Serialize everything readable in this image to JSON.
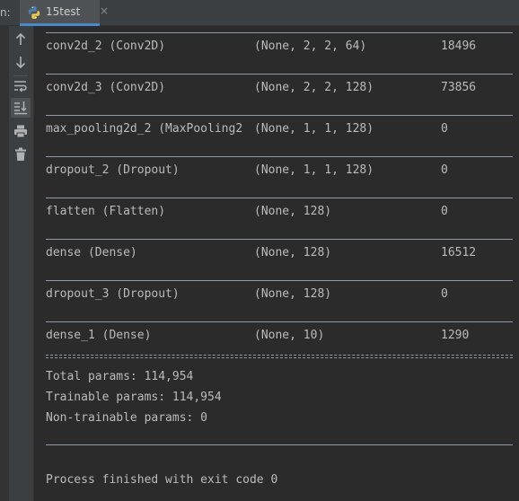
{
  "run_panel": {
    "label": "n:",
    "tab": {
      "title": "15test",
      "close": "×"
    }
  },
  "toolbar": {
    "buttons": [
      {
        "name": "rerun-up-icon",
        "glyph": "up-arrow"
      },
      {
        "name": "down-arrow-icon",
        "glyph": "down-arrow"
      },
      {
        "name": "soft-wrap-icon",
        "glyph": "wrap"
      },
      {
        "name": "scroll-to-end-icon",
        "glyph": "scroll-end"
      },
      {
        "name": "print-icon",
        "glyph": "printer"
      },
      {
        "name": "trash-icon",
        "glyph": "trash"
      }
    ]
  },
  "console": {
    "rows": [
      {
        "layer": "conv2d_2 (Conv2D)",
        "shape": "(None, 2, 2, 64)",
        "params": "18496"
      },
      {
        "layer": "conv2d_3 (Conv2D)",
        "shape": "(None, 2, 2, 128)",
        "params": "73856"
      },
      {
        "layer": "max_pooling2d_2 (MaxPooling2",
        "shape": "(None, 1, 1, 128)",
        "params": "0"
      },
      {
        "layer": "dropout_2 (Dropout)",
        "shape": "(None, 1, 1, 128)",
        "params": "0"
      },
      {
        "layer": "flatten (Flatten)",
        "shape": "(None, 128)",
        "params": "0"
      },
      {
        "layer": "dense (Dense)",
        "shape": "(None, 128)",
        "params": "16512"
      },
      {
        "layer": "dropout_3 (Dropout)",
        "shape": "(None, 128)",
        "params": "0"
      },
      {
        "layer": "dense_1 (Dense)",
        "shape": "(None, 10)",
        "params": "1290"
      }
    ],
    "total_params": "Total params: 114,954",
    "trainable_params": "Trainable params: 114,954",
    "non_trainable_params": "Non-trainable params: 0",
    "exit_message": "Process finished with exit code 0"
  },
  "colors": {
    "background": "#2b2b2b",
    "toolbar": "#3c3f41",
    "text": "#bbbbbb",
    "tab_accent": "#4a88c7"
  }
}
